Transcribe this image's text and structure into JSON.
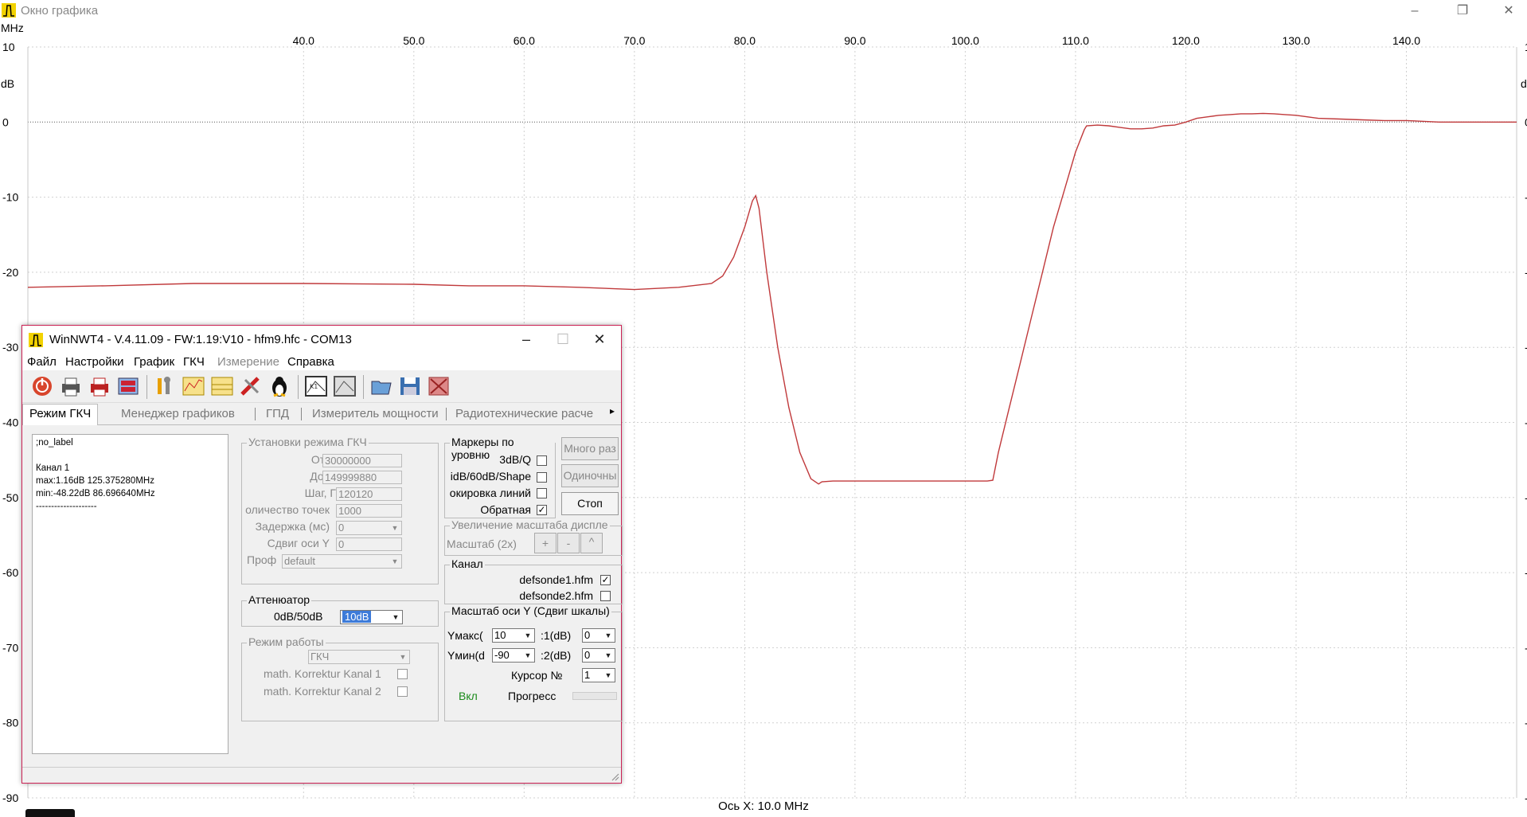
{
  "graph_window": {
    "title": "Окно графика",
    "x_unit": "MHz",
    "y_unit": "dB",
    "x_status": "Ось X: 10.0 MHz",
    "controls": {
      "minimize": "–",
      "restore": "❐",
      "close": "✕"
    }
  },
  "chart_data": {
    "type": "line",
    "xlim": [
      15.0,
      150.0
    ],
    "ylim": [
      -90,
      10
    ],
    "x_ticks": [
      "40.0",
      "50.0",
      "60.0",
      "70.0",
      "80.0",
      "90.0",
      "100.0",
      "110.0",
      "120.0",
      "130.0",
      "140.0"
    ],
    "x_tick_values": [
      40,
      50,
      60,
      70,
      80,
      90,
      100,
      110,
      120,
      130,
      140
    ],
    "y_ticks": [
      "10",
      "0",
      "-10",
      "-20",
      "-30",
      "-40",
      "-50",
      "-60",
      "-70",
      "-80",
      "-90"
    ],
    "y_tick_values": [
      10,
      0,
      -10,
      -20,
      -30,
      -40,
      -50,
      -60,
      -70,
      -80,
      -90
    ],
    "grid": true,
    "line_color": "#c0393b",
    "series": [
      {
        "x": [
          15,
          22,
          30,
          40,
          50,
          55,
          60,
          65,
          70,
          74,
          77,
          78,
          79,
          80,
          80.7,
          81,
          81.3,
          82,
          83,
          84,
          85,
          86,
          86.7,
          87,
          88,
          90,
          95,
          100,
          102,
          102.5,
          103,
          104,
          105,
          106,
          107,
          108,
          109,
          110,
          110.8,
          111,
          112,
          113,
          114,
          115,
          116,
          117,
          118,
          119,
          120,
          121,
          122,
          123,
          124,
          125,
          126,
          127,
          128,
          129,
          130,
          131,
          132,
          134,
          136,
          138,
          140,
          143,
          146,
          150
        ],
        "y": [
          -22,
          -21.8,
          -21.5,
          -21.5,
          -21.6,
          -21.8,
          -21.8,
          -22.0,
          -22.3,
          -22.0,
          -21.5,
          -20.5,
          -18.0,
          -14.0,
          -10.5,
          -9.8,
          -11.5,
          -20.0,
          -30.0,
          -38.0,
          -44.0,
          -47.5,
          -48.2,
          -47.9,
          -47.8,
          -47.8,
          -47.8,
          -47.8,
          -47.8,
          -47.7,
          -44.0,
          -38.0,
          -32.0,
          -26.0,
          -20.0,
          -14.0,
          -9.0,
          -4.0,
          -1.0,
          -0.5,
          -0.4,
          -0.5,
          -0.7,
          -0.9,
          -0.9,
          -0.8,
          -0.5,
          -0.4,
          0.0,
          0.5,
          0.7,
          0.9,
          1.0,
          1.1,
          1.1,
          1.16,
          1.1,
          1.0,
          0.9,
          0.7,
          0.5,
          0.4,
          0.3,
          0.2,
          0.2,
          0.0,
          0.0,
          0.0
        ]
      }
    ]
  },
  "dialog": {
    "title": "WinNWT4 - V.4.11.09 - FW:1.19:V10 - hfm9.hfc - COM13",
    "controls": {
      "minimize": "–",
      "maximize": "☐",
      "close": "✕"
    },
    "menu": [
      "Файл",
      "Настройки",
      "График",
      "ГКЧ",
      "Измерение",
      "Справка"
    ],
    "tabs": [
      "Режим ГКЧ",
      "Менеджер графиков",
      "ГПД",
      "Измеритель мощности",
      "Радиотехнические расче"
    ],
    "info_lines": [
      ";no_label",
      "",
      "Канал 1",
      "max:1.16dB 125.375280MHz",
      "min:-48.22dB 86.696640MHz",
      "--------------------"
    ],
    "settings": {
      "title": "Установки режима ГКЧ",
      "from_label": "От, Гц",
      "from_value": "30000000",
      "to_label": "До, Гц",
      "to_value": "149999880",
      "step_label": "Шаг, Гц",
      "step_value": "120120",
      "points_label": "оличество точек",
      "points_value": "1000",
      "delay_label": "Задержка (мс)",
      "delay_value": "0",
      "yshift_label": "Сдвиг оси Y",
      "yshift_value": "0",
      "profile_label": "Проф",
      "profile_value": "default"
    },
    "attenuator": {
      "title": "Аттенюатор",
      "label": "0dB/50dB",
      "value": "10dB"
    },
    "mode": {
      "title": "Режим работы",
      "value": "ГКЧ",
      "korr1": "math. Korrektur Kanal 1",
      "korr2": "math. Korrektur Kanal 2"
    },
    "markers": {
      "title": "Маркеры по уровню",
      "q3": "3dB/Q",
      "shape": "idB/60dB/Shape",
      "lines": "окировка линий",
      "inverse": "Обратная"
    },
    "buttons": {
      "multi": "Много раз",
      "single": "Одиночны",
      "stop": "Стоп"
    },
    "zoom": {
      "title": "Увеличение масштаба диспле",
      "label": "Масштаб (2x)",
      "plus": "+",
      "minus": "-",
      "caret": "^"
    },
    "channel": {
      "title": "Канал",
      "ch1": "defsonde1.hfm",
      "ch2": "defsonde2.hfm"
    },
    "yscale": {
      "title": "Масштаб оси Y (Сдвиг шкалы)",
      "ymax_label": "Yмакс(",
      "ymax_value": "10",
      "ymin_label": "Yмин(d",
      "ymin_value": "-90",
      "k1_label": ":1(dB)",
      "k1_value": "0",
      "k2_label": ":2(dB)",
      "k2_value": "0",
      "cursor_label": "Курсор №",
      "cursor_value": "1",
      "on_label": "Вкл",
      "progress_label": "Прогресс"
    }
  }
}
